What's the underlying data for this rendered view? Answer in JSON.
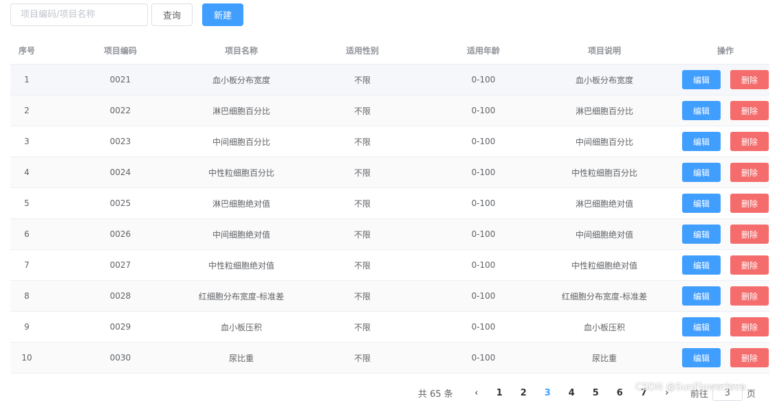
{
  "toolbar": {
    "search_placeholder": "项目编码/项目名称",
    "query_label": "查询",
    "new_label": "新建"
  },
  "table": {
    "headers": [
      "序号",
      "项目编码",
      "项目名称",
      "适用性别",
      "适用年龄",
      "项目说明",
      "操作"
    ],
    "rows": [
      {
        "index": "1",
        "code": "0021",
        "name": "血小板分布宽度",
        "gender": "不限",
        "age": "0-100",
        "desc": "血小板分布宽度"
      },
      {
        "index": "2",
        "code": "0022",
        "name": "淋巴细胞百分比",
        "gender": "不限",
        "age": "0-100",
        "desc": "淋巴细胞百分比"
      },
      {
        "index": "3",
        "code": "0023",
        "name": "中间细胞百分比",
        "gender": "不限",
        "age": "0-100",
        "desc": "中间细胞百分比"
      },
      {
        "index": "4",
        "code": "0024",
        "name": "中性粒细胞百分比",
        "gender": "不限",
        "age": "0-100",
        "desc": "中性粒细胞百分比"
      },
      {
        "index": "5",
        "code": "0025",
        "name": "淋巴细胞绝对值",
        "gender": "不限",
        "age": "0-100",
        "desc": "淋巴细胞绝对值"
      },
      {
        "index": "6",
        "code": "0026",
        "name": "中间细胞绝对值",
        "gender": "不限",
        "age": "0-100",
        "desc": "中间细胞绝对值"
      },
      {
        "index": "7",
        "code": "0027",
        "name": "中性粒细胞绝对值",
        "gender": "不限",
        "age": "0-100",
        "desc": "中性粒细胞绝对值"
      },
      {
        "index": "8",
        "code": "0028",
        "name": "红细胞分布宽度-标准差",
        "gender": "不限",
        "age": "0-100",
        "desc": "红细胞分布宽度-标准差"
      },
      {
        "index": "9",
        "code": "0029",
        "name": "血小板压积",
        "gender": "不限",
        "age": "0-100",
        "desc": "血小板压积"
      },
      {
        "index": "10",
        "code": "0030",
        "name": "尿比重",
        "gender": "不限",
        "age": "0-100",
        "desc": "尿比重"
      }
    ],
    "edit_label": "编辑",
    "delete_label": "删除"
  },
  "pagination": {
    "total_text": "共 65 条",
    "prev_icon": "chevron-left-icon",
    "next_icon": "chevron-right-icon",
    "pages": [
      "1",
      "2",
      "3",
      "4",
      "5",
      "6",
      "7"
    ],
    "current_page": "3",
    "goto_label": "前往",
    "goto_value": "3",
    "page_suffix": "页"
  },
  "watermark": "CSDN @SunFlowerJava",
  "colors": {
    "primary": "#409eff",
    "danger": "#f56c6c",
    "row_highlight": "#f5f7fa"
  }
}
